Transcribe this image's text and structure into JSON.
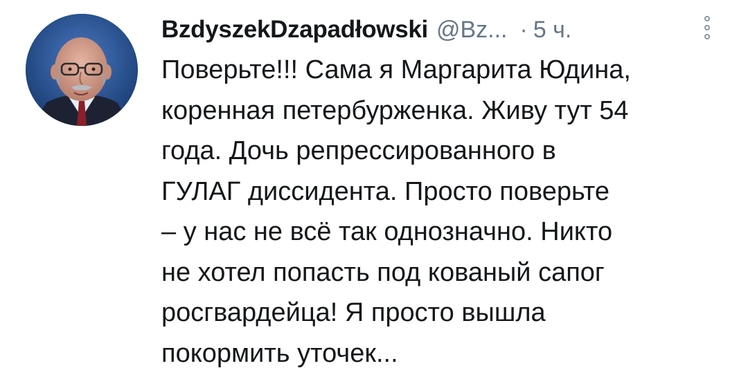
{
  "tweet": {
    "author_name": "BzdyszekDzapadłowski",
    "author_handle": "@Bz...",
    "separator": "·",
    "timestamp": "5 ч.",
    "avatar_icon": "user-avatar-photo",
    "more_icon": "vertical-dots-icon",
    "text_lines": [
      "Поверьте!!! Сама я Маргарита Юдина,",
      "коренная петербурженка. Живу тут 54",
      "года. Дочь репрессированного в",
      "ГУЛАГ диссидента. Просто поверьте",
      "– у нас не всё так однозначно. Никто",
      "не хотел попасть под кованый сапог",
      "росгвардейца! Я просто вышла",
      "покормить уточек..."
    ]
  }
}
